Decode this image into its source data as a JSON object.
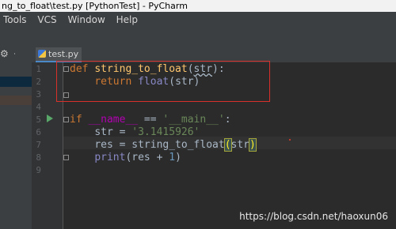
{
  "window": {
    "title": "ng_to_float\\test.py [PythonTest] - PyCharm"
  },
  "menu": {
    "items": [
      "Tools",
      "VCS",
      "Window",
      "Help"
    ]
  },
  "editor": {
    "tab_label": "test.py",
    "line_numbers": [
      "1",
      "2",
      "3",
      "4",
      "5",
      "6",
      "7",
      "8",
      "9"
    ],
    "lines": {
      "l1": {
        "kw": "def",
        "fn": "string_to_float",
        "p1": "(",
        "arg": "str",
        "p2": "):"
      },
      "l2": {
        "kw": "return",
        "bi": "float",
        "rest": "(str)"
      },
      "l5": {
        "kw": "if",
        "name": "__name__",
        "op": " == ",
        "st": "'__main__'",
        "colon": ":"
      },
      "l6": {
        "var": "str",
        "op": " = ",
        "st": "'3.1415926'"
      },
      "l7": {
        "pre": "res = string_to_float",
        "open": "(",
        "mid": "str",
        "close": ")"
      },
      "l8": {
        "bi": "print",
        "pre": "(res + ",
        "nm": "1",
        "close": ")"
      }
    }
  },
  "watermark": "https://blog.csdn.net/haoxun06",
  "colors": {
    "accent": "#4a88c7",
    "highlight_box": "#d9302c",
    "run": "#59a869"
  }
}
